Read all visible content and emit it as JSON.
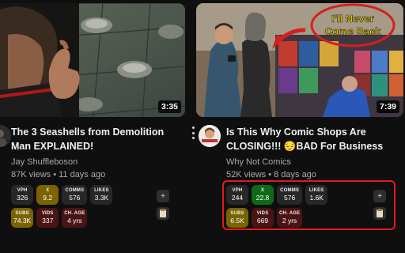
{
  "videos": [
    {
      "duration": "3:35",
      "title": "The 3 Seashells from Demolition Man EXPLAINED!",
      "channel": "Jay Shuffleboson",
      "meta": "87K views • 11 days ago",
      "stats": [
        {
          "label": "VPH",
          "value": "326"
        },
        {
          "label": "X",
          "value": "9.2"
        },
        {
          "label": "COMMS",
          "value": "576"
        },
        {
          "label": "LIKES",
          "value": "3.3K"
        },
        {
          "label": "SUBS",
          "value": "74.3K"
        },
        {
          "label": "VIDS",
          "value": "337"
        },
        {
          "label": "CH. AGE",
          "value": "4 yrs"
        }
      ]
    },
    {
      "duration": "7:39",
      "title": "Is This Why Comic Shops Are CLOSING!!! 😔BAD For Business",
      "channel": "Why Not Comics",
      "meta": "52K views • 8 days ago",
      "thumb_caption": "I'll Never Come Back",
      "stats": [
        {
          "label": "VPH",
          "value": "244"
        },
        {
          "label": "X",
          "value": "22.8"
        },
        {
          "label": "COMMS",
          "value": "576"
        },
        {
          "label": "LIKES",
          "value": "1.6K"
        },
        {
          "label": "SUBS",
          "value": "6.5K"
        },
        {
          "label": "VIDS",
          "value": "669"
        },
        {
          "label": "CH. AGE",
          "value": "2 yrs"
        }
      ]
    }
  ],
  "side_buttons": {
    "add_label": "+"
  },
  "colors": {
    "background": "#0f0f0f",
    "badge_olive": "#7a6300",
    "badge_maroon": "#4a1414",
    "badge_green": "#0e6a19",
    "badge_dark": "#272727",
    "highlight": "#e21b1b"
  }
}
